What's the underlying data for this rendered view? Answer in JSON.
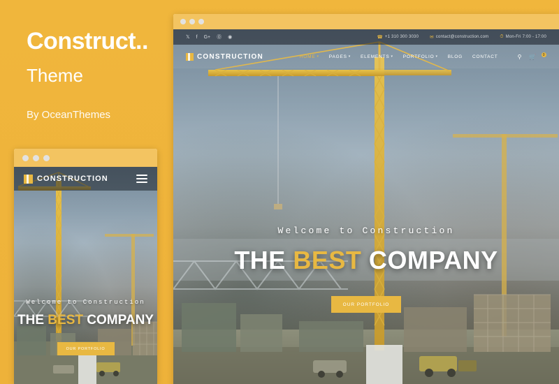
{
  "left": {
    "title": "Construct..",
    "subtitle": "Theme",
    "author": "By OceanThemes"
  },
  "colors": {
    "page_background": "#f0b63c",
    "accent": "#e8b842",
    "chrome_bar": "#f3c461",
    "text_light": "#ffffff"
  },
  "desktop_preview": {
    "chrome_dots": [
      "dot-1",
      "dot-2",
      "dot-3"
    ],
    "topbar": {
      "social": [
        "twitter-icon",
        "facebook-icon",
        "google-plus-icon",
        "pinterest-icon",
        "dribbble-icon"
      ],
      "phone": "+1 310 300 3030",
      "email": "contact@construction.com",
      "hours": "Mon-Fri 7:00 - 17:00"
    },
    "navbar": {
      "brand": "CONSTRUCTION",
      "menu": [
        {
          "label": "HOME",
          "caret": true,
          "active": true
        },
        {
          "label": "PAGES",
          "caret": true,
          "active": false
        },
        {
          "label": "ELEMENTS",
          "caret": true,
          "active": false
        },
        {
          "label": "PORTFOLIO",
          "caret": true,
          "active": false
        },
        {
          "label": "BLOG",
          "caret": false,
          "active": false
        },
        {
          "label": "CONTACT",
          "caret": false,
          "active": false
        }
      ],
      "search_icon": "search-icon",
      "cart_icon": "cart-icon",
      "cart_count": "0"
    },
    "hero": {
      "kicker": "Welcome to Construction",
      "title_part1": "THE ",
      "title_accent": "BEST",
      "title_part2": " COMPANY",
      "button": "OUR PORTFOLIO"
    }
  },
  "mobile_preview": {
    "chrome_dots": [
      "dot-1",
      "dot-2",
      "dot-3"
    ],
    "navbar": {
      "brand": "CONSTRUCTION",
      "menu_icon": "hamburger-icon"
    },
    "hero": {
      "kicker": "Welcome to Construction",
      "title_part1": "THE ",
      "title_accent": "BEST",
      "title_part2": " COMPANY",
      "button": "OUR PORTFOLIO"
    }
  }
}
